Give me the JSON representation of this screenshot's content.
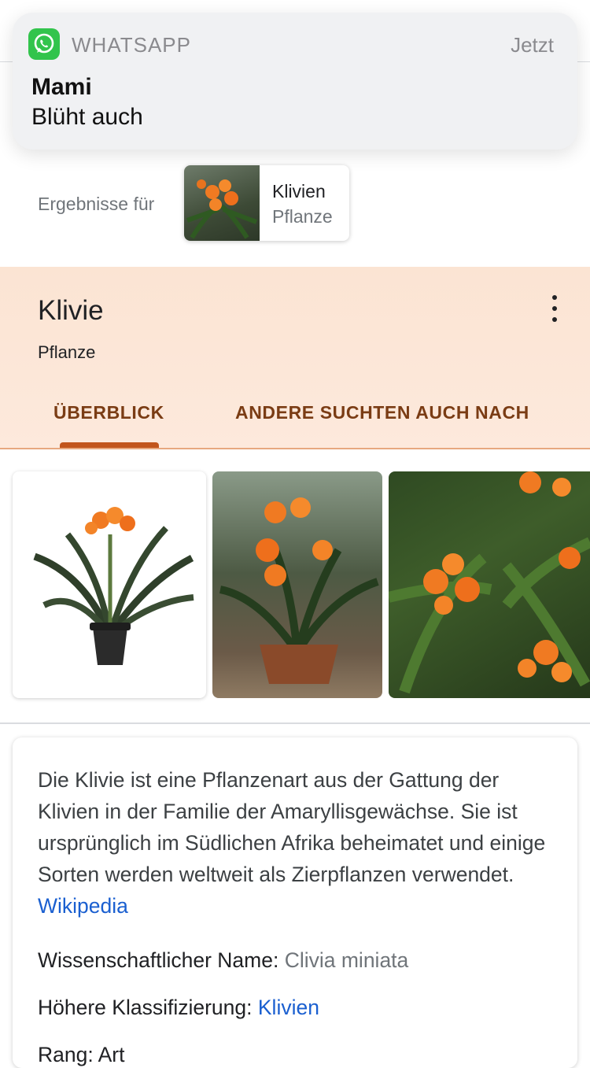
{
  "notification": {
    "app_name": "WHATSAPP",
    "time": "Jetzt",
    "sender": "Mami",
    "message": "Blüht auch",
    "icon": "whatsapp-icon",
    "accent": "#32c44c"
  },
  "results": {
    "label": "Ergebnisse für",
    "chip_title": "Klivien",
    "chip_subtitle": "Pflanze"
  },
  "knowledge_panel": {
    "title": "Klivie",
    "subtitle": "Pflanze",
    "tabs": [
      {
        "label": "ÜBERBLICK",
        "active": true
      },
      {
        "label": "ANDERE SUCHTEN AUCH NACH",
        "active": false
      }
    ],
    "accent": "#c2551c"
  },
  "description": {
    "text": "Die Klivie ist eine Pflanzenart aus der Gattung der Klivien in der Familie der Amaryllisgewächse. Sie ist ursprünglich im Südlichen Afrika beheimatet und einige Sorten werden weltweit als Zierpflanzen verwendet.",
    "source_link": "Wikipedia",
    "facts": [
      {
        "label": "Wissenschaftlicher Name:",
        "value": "Clivia miniata"
      },
      {
        "label": "Höhere Klassifizierung:",
        "value": "Klivien"
      },
      {
        "label": "Rang: Art",
        "value": ""
      }
    ]
  }
}
